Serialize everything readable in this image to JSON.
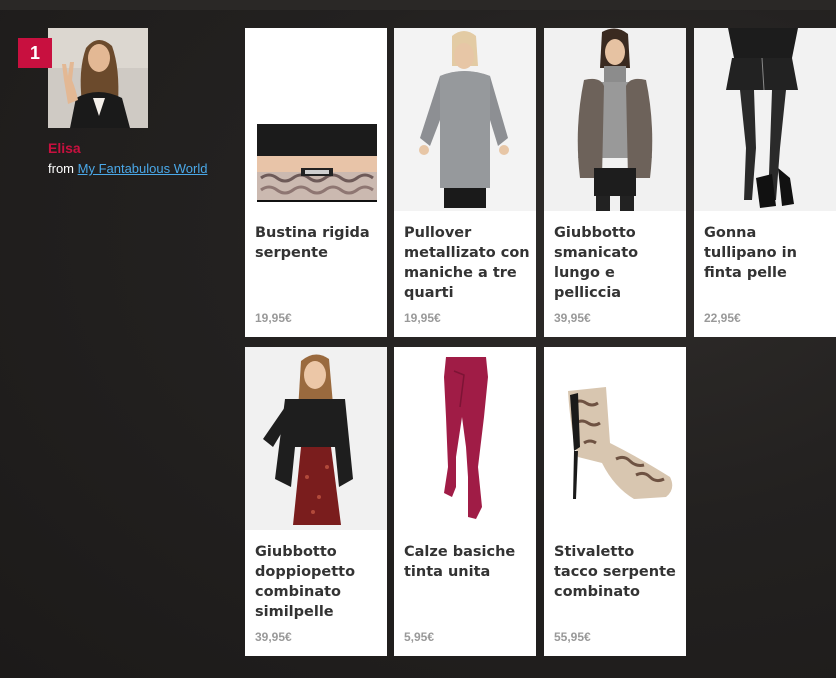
{
  "profile": {
    "rank": "1",
    "name": "Elisa",
    "from_label": "from",
    "blog_link": "My Fantabulous World"
  },
  "products": [
    {
      "title": "Bustina rigida serpente",
      "price": "19,95€",
      "image": "snake-clutch-image"
    },
    {
      "title": "Pullover metallizato con maniche a tre quarti",
      "price": "19,95€",
      "image": "grey-pullover-image"
    },
    {
      "title": "Giubbotto smanicato lungo e pelliccia",
      "price": "39,95€",
      "image": "fur-vest-image"
    },
    {
      "title": "Gonna tullipano in finta pelle",
      "price": "22,95€",
      "image": "leather-skirt-image"
    },
    {
      "title": "Giubbotto doppiopetto combinato similpelle",
      "price": "39,95€",
      "image": "leather-jacket-image"
    },
    {
      "title": "Calze basiche tinta unita",
      "price": "5,95€",
      "image": "burgundy-tights-image"
    },
    {
      "title": "Stivaletto tacco serpente combinato",
      "price": "55,95€",
      "image": "snake-ankle-boot-image"
    }
  ],
  "colors": {
    "accent": "#c8103f",
    "link": "#4aa8e8",
    "background": "#1f1d1c"
  }
}
